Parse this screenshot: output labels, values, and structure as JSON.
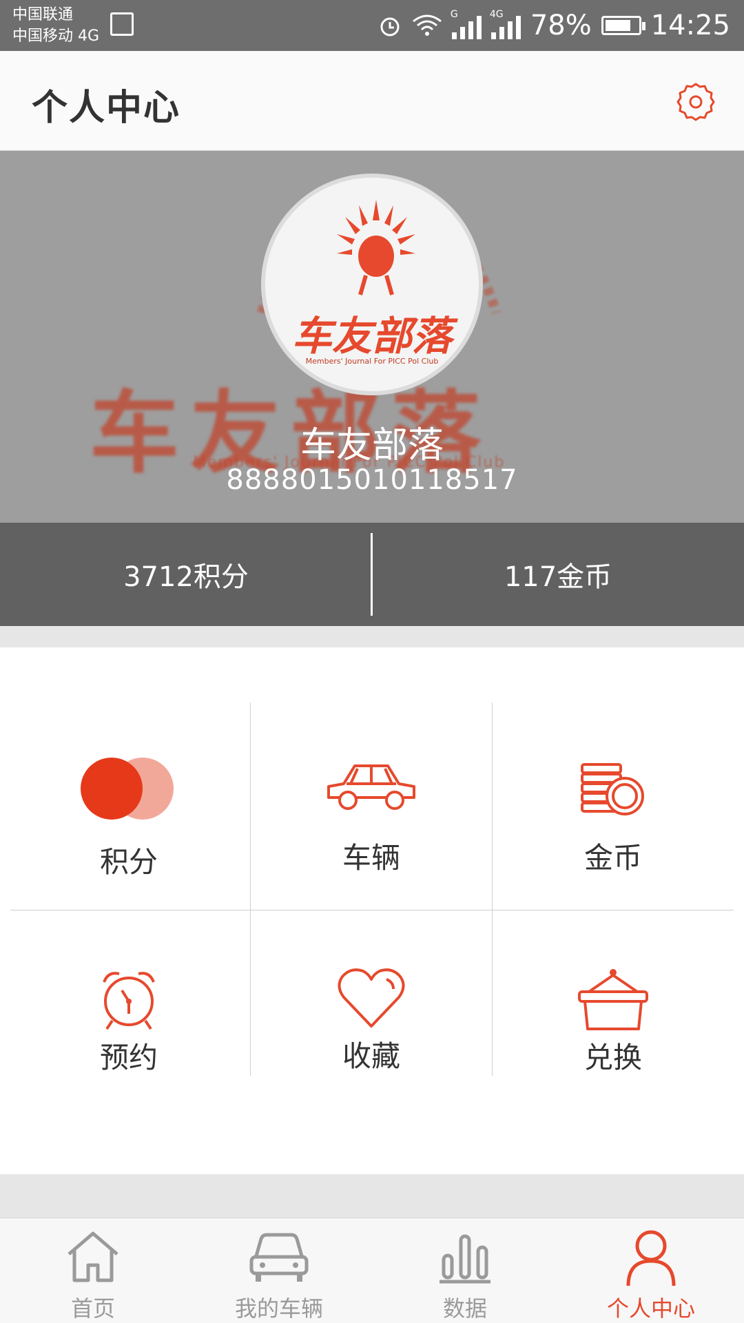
{
  "status_bar": {
    "carrier1": "中国联通",
    "carrier2": "中国移动 4G",
    "sim1_label": "G",
    "sim2_label": "4G",
    "battery": "78%",
    "time": "14:25"
  },
  "app_bar": {
    "title": "个人中心",
    "settings_icon": "gear-icon"
  },
  "profile": {
    "avatar_brand": "车友部落",
    "avatar_subtitle": "Members' Journal For PICC Pol Club",
    "name": "车友部落",
    "member_id": "8888015010118517"
  },
  "stats": {
    "points": "3712积分",
    "coins": "117金币"
  },
  "menu": [
    {
      "label": "积分",
      "icon": "points-circles-icon"
    },
    {
      "label": "车辆",
      "icon": "car-icon"
    },
    {
      "label": "金币",
      "icon": "coins-icon"
    },
    {
      "label": "预约",
      "icon": "alarm-clock-icon"
    },
    {
      "label": "收藏",
      "icon": "heart-icon"
    },
    {
      "label": "兑换",
      "icon": "basket-icon"
    }
  ],
  "tabs": [
    {
      "label": "首页",
      "icon": "home-icon"
    },
    {
      "label": "我的车辆",
      "icon": "car-icon"
    },
    {
      "label": "数据",
      "icon": "bar-chart-icon"
    },
    {
      "label": "个人中心",
      "icon": "person-icon",
      "active": true
    }
  ],
  "colors": {
    "accent": "#e6492d",
    "stats_bg": "#616161",
    "hero_bg": "#9e9e9e"
  }
}
